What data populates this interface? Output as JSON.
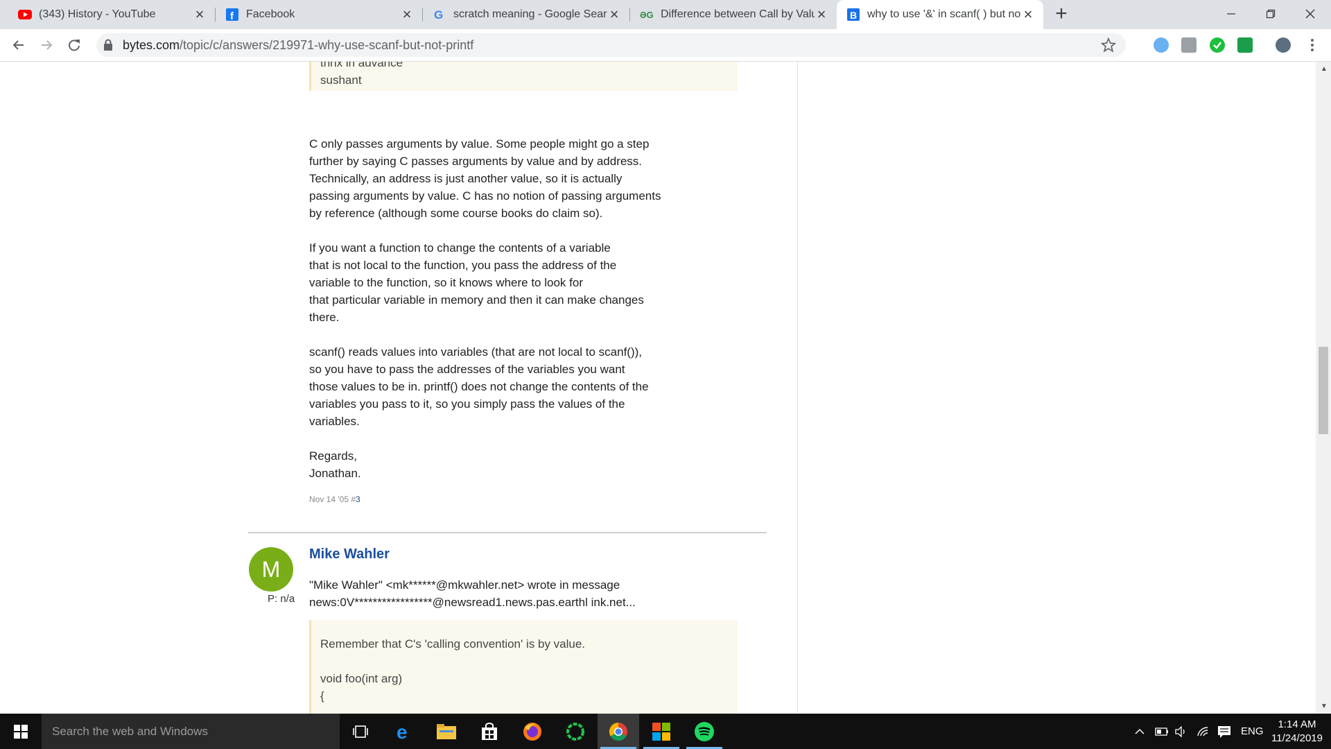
{
  "browser": {
    "tabs": [
      {
        "title": "(343) History - YouTube",
        "icon": "youtube-icon"
      },
      {
        "title": "Facebook",
        "icon": "facebook-icon"
      },
      {
        "title": "scratch meaning - Google Search",
        "icon": "google-icon"
      },
      {
        "title": "Difference between Call by Value",
        "icon": "geeksforgeeks-icon"
      },
      {
        "title": "why to use '&' in scanf( ) but not",
        "icon": "bytes-icon",
        "active": true
      }
    ],
    "new_tab_label": "+",
    "url_domain": "bytes.com",
    "url_path": "/topic/c/answers/219971-why-use-scanf-but-not-printf"
  },
  "page": {
    "top_quote": [
      "thnx in advance",
      "sushant"
    ],
    "answer_paragraphs": [
      [
        "C only passes arguments by value. Some people might go a step",
        "further by saying C passes arguments by value and by address.",
        "Technically, an address is just another value, so it is actually",
        "passing arguments by value. C has no notion of passing arguments",
        "by reference (although some course books do claim so)."
      ],
      [
        "If you want a function to change the contents of a variable",
        "that is not local to the function, you pass the address of the",
        "variable to the function, so it knows where to look for",
        "that particular variable in memory and then it can make changes",
        "there."
      ],
      [
        "scanf() reads values into variables (that are not local to scanf()),",
        "so you have to pass the addresses of the variables you want",
        "those values to be in. printf() does not change the contents of the",
        "variables you pass to it, so you simply pass the values of the",
        "variables."
      ],
      [
        "Regards,",
        "Jonathan."
      ]
    ],
    "post_date": "Nov 14 '05 #",
    "post_number": "3",
    "next_post": {
      "avatar_letter": "M",
      "avatar_color": "#7aae18",
      "post_count": "P: n/a",
      "author": "Mike Wahler",
      "lines": [
        "\"Mike Wahler\" <mk******@mkwahler.net> wrote in message",
        "news:0V*****************@newsread1.news.pas.earthl ink.net..."
      ],
      "quote": [
        "Remember that C's 'calling convention' is by value.",
        "",
        "void foo(int arg)",
        "{"
      ]
    }
  },
  "taskbar": {
    "search_placeholder": "Search the web and Windows",
    "apps": [
      "task-view",
      "edge",
      "file-explorer",
      "store",
      "firefox",
      "cortana-ring",
      "chrome",
      "windows-apps",
      "spotify"
    ],
    "language": "ENG",
    "time": "1:14 AM",
    "date": "11/24/2019"
  }
}
